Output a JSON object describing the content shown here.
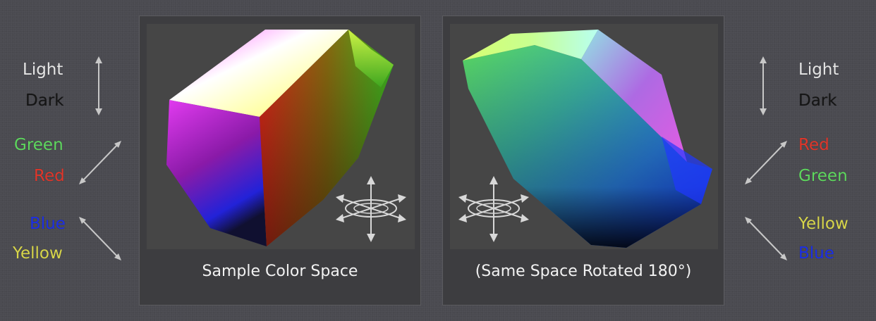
{
  "left_legend": {
    "light": "Light",
    "dark": "Dark",
    "green": "Green",
    "red": "Red",
    "blue": "Blue",
    "yellow": "Yellow"
  },
  "right_legend": {
    "light": "Light",
    "dark": "Dark",
    "red": "Red",
    "green": "Green",
    "yellow": "Yellow",
    "blue": "Blue"
  },
  "panels": [
    {
      "caption": "Sample Color Space"
    },
    {
      "caption": "(Same Space Rotated 180°)"
    }
  ],
  "colors": {
    "light": "#e6e6e6",
    "dark": "#1a1a1a",
    "green": "#5ed85e",
    "red": "#e0362a",
    "blue": "#1c2fe6",
    "yellow": "#d8d64a",
    "arrow": "#c8c8c8"
  },
  "icons": [
    "rotate-3d-icon",
    "vertical-arrow-icon",
    "diagonal-arrow-icon"
  ]
}
